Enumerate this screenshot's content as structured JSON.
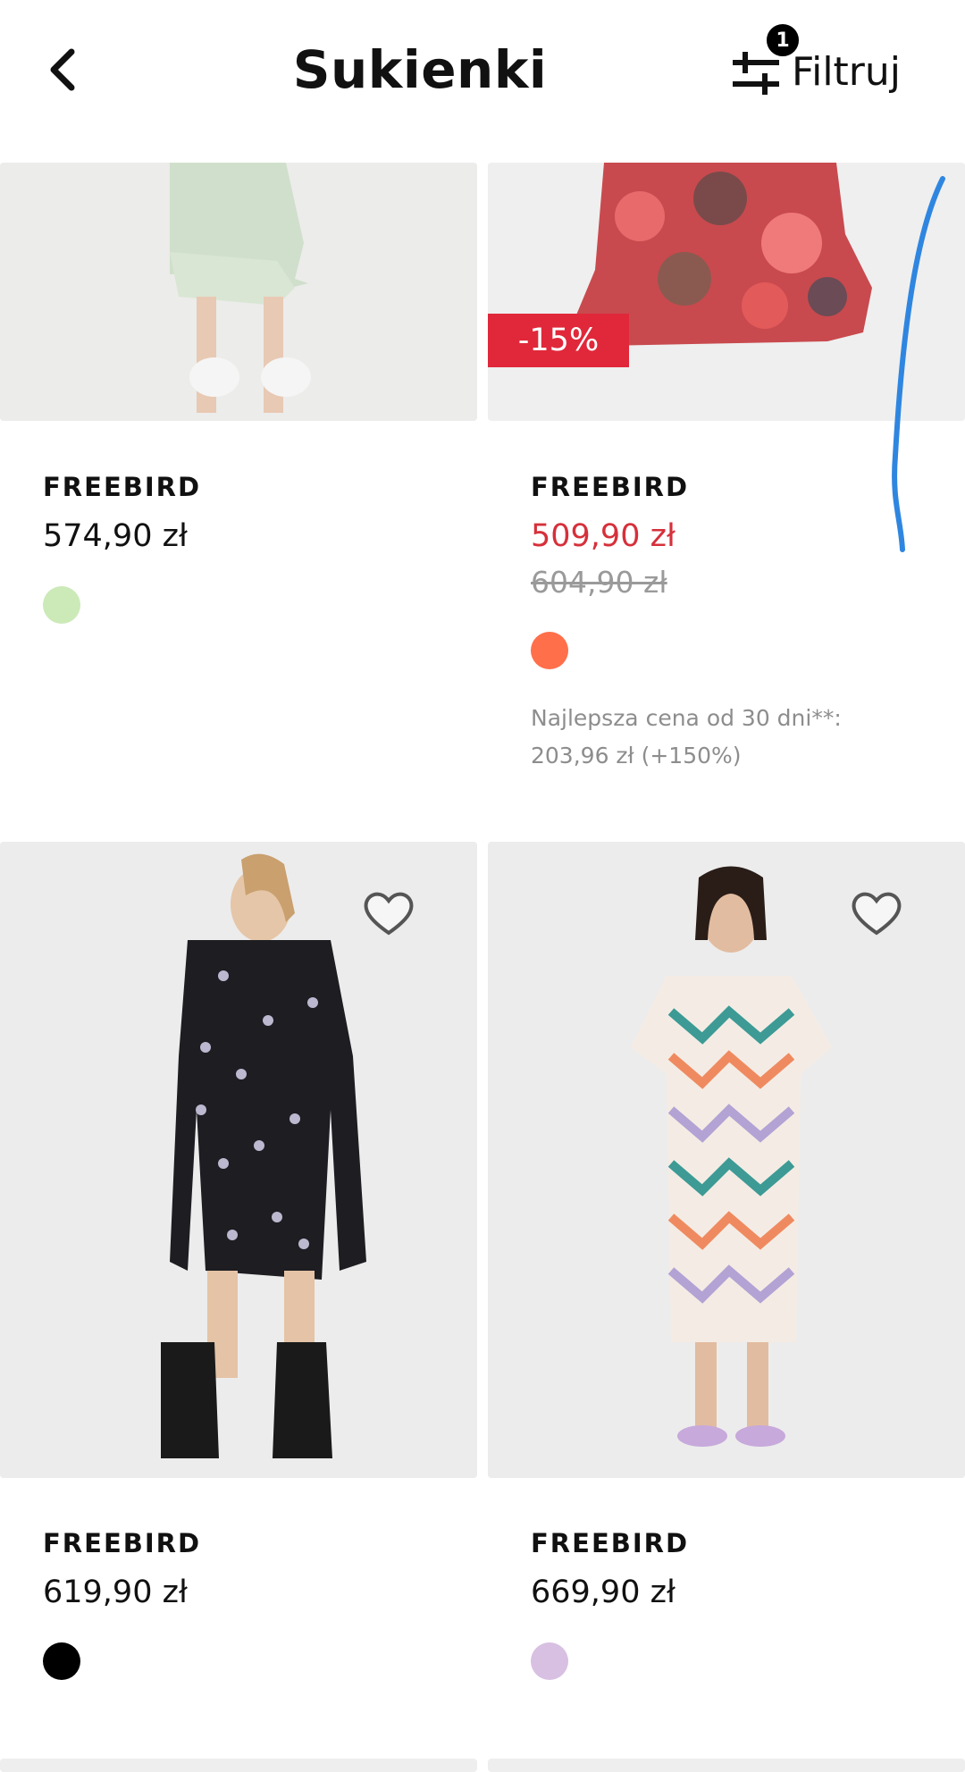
{
  "header": {
    "title": "Sukienki",
    "filter_label": "Filtruj",
    "filter_count": "1"
  },
  "products": [
    {
      "brand": "FREEBIRD",
      "price": "574,90 zł",
      "swatch_color": "#cbeab8"
    },
    {
      "brand": "FREEBIRD",
      "price": "509,90 zł",
      "old_price": "604,90 zł",
      "discount": "-15%",
      "swatch_color": "#ff6f4a",
      "best_price_note": "Najlepsza cena od 30 dni**: 203,96 zł (+150%)"
    },
    {
      "brand": "FREEBIRD",
      "price": "619,90 zł",
      "swatch_color": "#000000"
    },
    {
      "brand": "FREEBIRD",
      "price": "669,90 zł",
      "swatch_color": "#d8c0e2"
    }
  ],
  "colors": {
    "sale_red": "#d6303a",
    "discount_badge": "#e0283a",
    "scroll_indicator": "#2f86e0"
  }
}
